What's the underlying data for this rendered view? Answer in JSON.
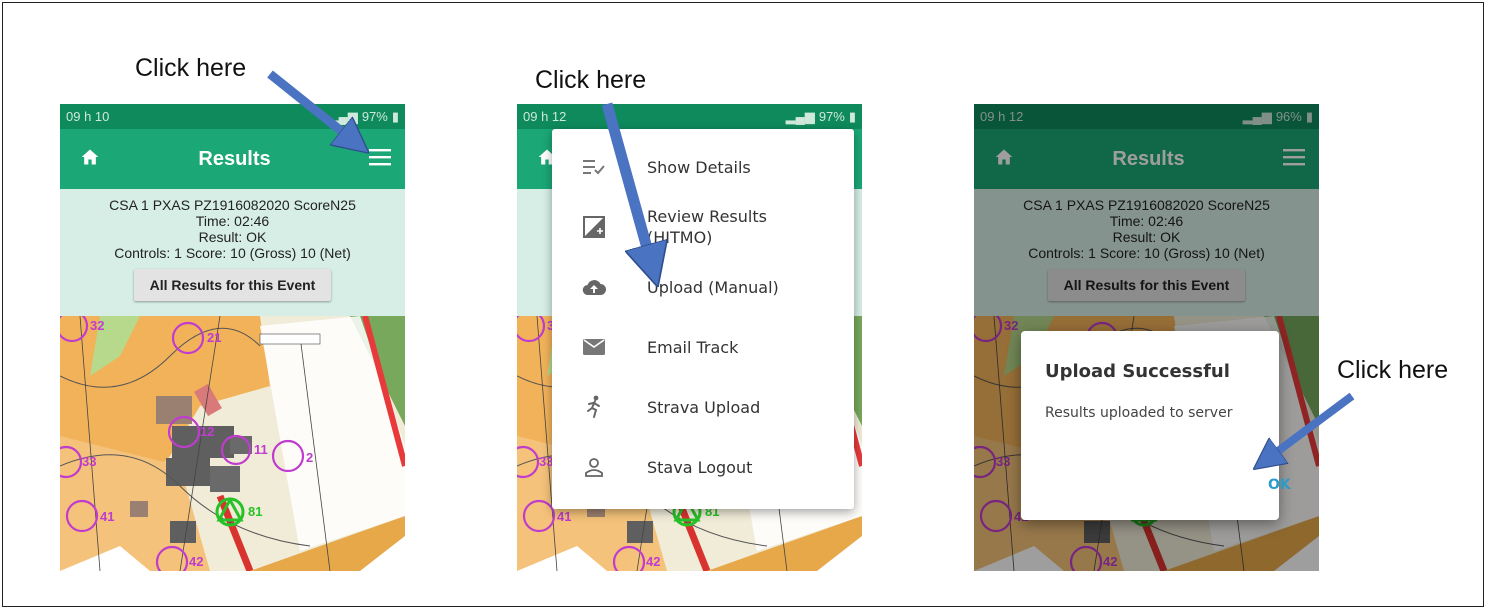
{
  "captions": {
    "step1": "Click here",
    "step2": "Click here",
    "step3": "Click here"
  },
  "phones": [
    {
      "status_time": "09 h 10",
      "battery": "97%",
      "title": "Results",
      "course": "CSA 1 PXAS  PZ1916082020 ScoreN25",
      "time": "Time: 02:46",
      "result": "Result: OK",
      "controls": "Controls: 1 Score: 10 (Gross)  10 (Net)",
      "results_button": "All Results for this Event"
    },
    {
      "status_time": "09 h 12",
      "battery": "97%",
      "menu": [
        {
          "label": "Show Details",
          "icon": "checklist-icon"
        },
        {
          "label": "Review Results (HITMO)",
          "icon": "image-add-icon"
        },
        {
          "label": "Upload (Manual)",
          "icon": "cloud-upload-icon"
        },
        {
          "label": "Email Track",
          "icon": "mail-icon"
        },
        {
          "label": "Strava Upload",
          "icon": "runner-icon"
        },
        {
          "label": "Stava Logout",
          "icon": "person-icon"
        }
      ]
    },
    {
      "status_time": "09 h 12",
      "battery": "96%",
      "title": "Results",
      "course": "CSA 1 PXAS  PZ1916082020 ScoreN25",
      "time": "Time: 02:46",
      "result": "Result: OK",
      "controls": "Controls: 1 Score: 10 (Gross)  10 (Net)",
      "results_button": "All Results for this Event",
      "dialog": {
        "title": "Upload Successful",
        "message": "Results uploaded to server",
        "ok": "OK"
      }
    }
  ],
  "map_labels": [
    "32",
    "21",
    "12",
    "11",
    "2",
    "33",
    "41",
    "81",
    "42"
  ],
  "colors": {
    "status_bar": "#0e8a5c",
    "app_bar": "#1ba876",
    "info_panel": "#d7eee7",
    "arrow": "#4a73c2",
    "control_circle": "#c03ccf",
    "dialog_ok": "#2b9cc9"
  }
}
